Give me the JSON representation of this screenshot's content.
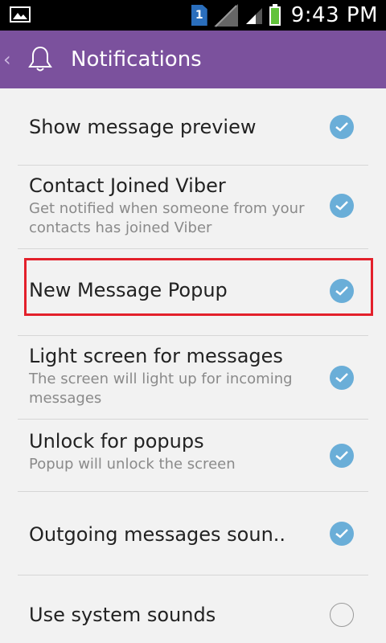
{
  "status_bar": {
    "time": "9:43 PM",
    "sim_label": "1",
    "icons": [
      "gallery-icon",
      "sim-icon",
      "no-signal-icon",
      "signal-icon",
      "battery-icon"
    ]
  },
  "header": {
    "title": "Notifications",
    "back_icon": "back-chevron-icon",
    "icon": "bell-icon",
    "color": "#7b519d"
  },
  "settings": [
    {
      "title": "Show message preview",
      "summary": "",
      "checked": true
    },
    {
      "title": "Contact Joined Viber",
      "summary": "Get notified when someone from your contacts has joined Viber",
      "checked": true
    },
    {
      "title": "New Message Popup",
      "summary": "",
      "checked": true,
      "highlighted": true
    },
    {
      "title": "Light screen for messages",
      "summary": "The screen will light up for incoming messages",
      "checked": true
    },
    {
      "title": "Unlock for popups",
      "summary": "Popup will unlock the screen",
      "checked": true
    },
    {
      "title": "Outgoing messages soun..",
      "summary": "",
      "checked": true
    },
    {
      "title": "Use system sounds",
      "summary": "",
      "checked": false
    }
  ],
  "colors": {
    "check_on": "#6aaed8",
    "highlight": "#e3202b"
  }
}
